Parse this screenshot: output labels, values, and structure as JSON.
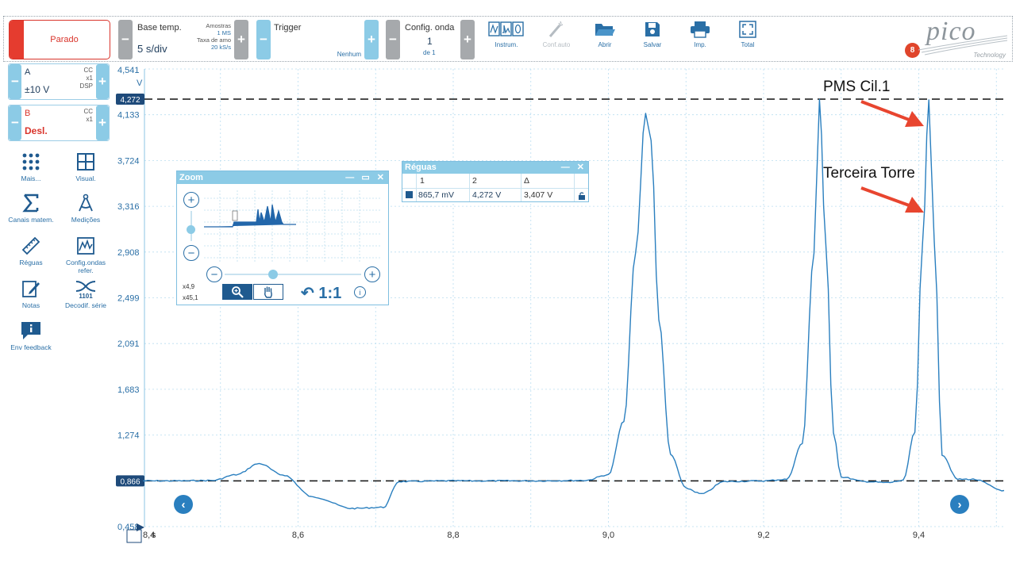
{
  "toolbar": {
    "stop_label": "Parado",
    "timebase_label": "Base temp.",
    "timebase_value": "5 s/div",
    "samples_label": "Amostras",
    "samples_value": "1 MS",
    "rate_label": "Taxa de amo",
    "rate_value": "20 kS/s",
    "trigger_label": "Trigger",
    "trigger_mode": "Nenhum",
    "wave_label": "Config. onda",
    "wave_index": "1",
    "wave_of": "de 1",
    "buttons": [
      {
        "label": "Instrum.",
        "icon": "instruments-icon"
      },
      {
        "label": "Conf.auto",
        "icon": "auto-setup-icon"
      },
      {
        "label": "Abrir",
        "icon": "folder-open-icon"
      },
      {
        "label": "Salvar",
        "icon": "save-icon"
      },
      {
        "label": "Imp.",
        "icon": "print-icon"
      },
      {
        "label": "Total",
        "icon": "fullscreen-icon"
      }
    ],
    "notification_count": "8",
    "logo_text": "pico",
    "logo_sub": "Technology"
  },
  "channels": {
    "a": {
      "name": "A",
      "range": "±10 V",
      "flags": [
        "CC",
        "x1",
        "DSP"
      ],
      "color": "#1f3d5c"
    },
    "b": {
      "name": "B",
      "range": "Desl.",
      "flags": [
        "CC",
        "x1"
      ],
      "color": "#d9342b"
    }
  },
  "tools": [
    {
      "label": "Mais...",
      "icon": "more-dots-icon"
    },
    {
      "label": "Visual.",
      "icon": "view-grid-icon"
    },
    {
      "label": "Canais matem.",
      "icon": "sigma-icon"
    },
    {
      "label": "Medições",
      "icon": "measurement-icon"
    },
    {
      "label": "Réguas",
      "icon": "ruler-icon"
    },
    {
      "label": "Config.ondas refer.",
      "icon": "reference-wave-icon"
    },
    {
      "label": "Notas",
      "icon": "notes-icon"
    },
    {
      "label": "Decodif. série",
      "icon": "serial-decode-icon"
    },
    {
      "label": "Env feedback",
      "icon": "feedback-icon"
    }
  ],
  "plot": {
    "unit": "V",
    "marker_high": "4,272",
    "marker_low": "0,866",
    "y_ticks": [
      "4,541",
      "4,133",
      "3,724",
      "3,316",
      "2,908",
      "2,499",
      "2,091",
      "1,683",
      "1,274",
      "0,866",
      "0,458"
    ],
    "x_ticks": [
      "8,4",
      "8,6",
      "8,8",
      "9,0",
      "9,2",
      "9,4"
    ],
    "x_tick_suffix": "s",
    "annotations": [
      "PMS Cil.1",
      "Terceira Torre"
    ],
    "trace_color": "#2a7fbf"
  },
  "chart_data": {
    "type": "line",
    "title": "",
    "xlabel": "s",
    "ylabel": "V",
    "xlim": [
      8.4,
      9.51
    ],
    "ylim": [
      0.458,
      4.541
    ],
    "series": [
      {
        "name": "A",
        "x": [
          8.4,
          8.45,
          8.49,
          8.52,
          8.55,
          8.58,
          8.62,
          8.67,
          8.71,
          8.73,
          8.8,
          8.9,
          8.97,
          9.0,
          9.02,
          9.035,
          9.048,
          9.055,
          9.065,
          9.08,
          9.1,
          9.12,
          9.15,
          9.2,
          9.23,
          9.25,
          9.265,
          9.272,
          9.28,
          9.29,
          9.3,
          9.33,
          9.36,
          9.38,
          9.395,
          9.405,
          9.413,
          9.42,
          9.43,
          9.45,
          9.47,
          9.51
        ],
        "y": [
          0.866,
          0.866,
          0.87,
          0.92,
          1.02,
          0.92,
          0.72,
          0.62,
          0.63,
          0.86,
          0.866,
          0.866,
          0.87,
          0.92,
          1.4,
          2.9,
          4.15,
          3.9,
          2.3,
          1.1,
          0.8,
          0.75,
          0.86,
          0.866,
          0.88,
          1.2,
          2.9,
          4.27,
          3.0,
          1.3,
          0.9,
          0.86,
          0.85,
          0.87,
          1.3,
          3.0,
          4.27,
          3.0,
          1.1,
          0.88,
          0.88,
          0.78
        ]
      }
    ],
    "reference_lines": [
      4.272,
      0.866
    ],
    "grid": true
  },
  "zoom_panel": {
    "title": "Zoom",
    "x_factor": "x4,9",
    "y_factor": "x45,1",
    "reset_label": "1:1",
    "info_symbol": "i"
  },
  "rulers_panel": {
    "title": "Réguas",
    "headers": [
      "1",
      "2",
      "Δ"
    ],
    "row": [
      "865,7 mV",
      "4,272 V",
      "3,407 V"
    ]
  },
  "nav": {
    "prev": "‹",
    "next": "›"
  }
}
